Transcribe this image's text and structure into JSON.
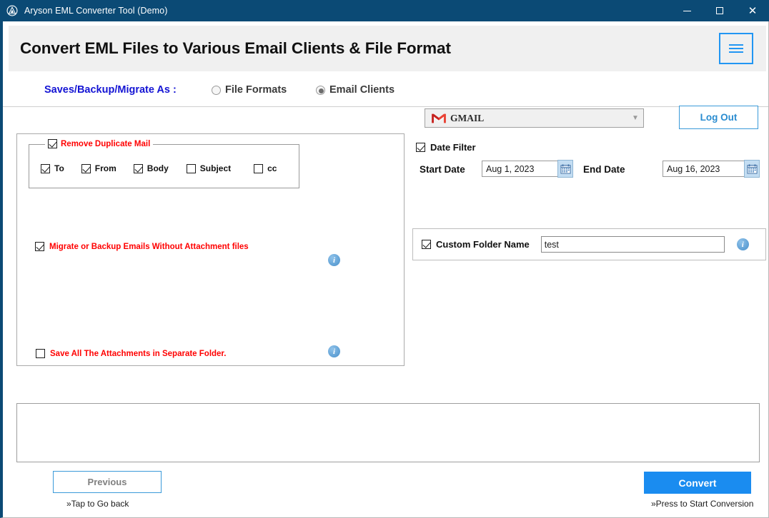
{
  "window": {
    "title": "Aryson EML Converter Tool (Demo)",
    "logo_icon": "aryson-logo-icon",
    "minimize_icon": "minimize-icon",
    "maximize_icon": "maximize-icon",
    "close_icon": "close-icon",
    "titlebar_color": "#0b4a75"
  },
  "header": {
    "title": "Convert EML Files to Various Email Clients & File Format",
    "menu_icon": "hamburger-menu-icon",
    "accent_color": "#2196f3"
  },
  "toolbar": {
    "save_as_label": "Saves/Backup/Migrate As :",
    "save_as_color": "#1414d4",
    "radios": [
      {
        "label": "File Formats",
        "selected": false
      },
      {
        "label": "Email Clients",
        "selected": true
      }
    ],
    "target_combo": {
      "value": "GMAIL",
      "icon": "gmail-icon",
      "chevron_icon": "chevron-down-icon"
    },
    "logout_label": "Log Out",
    "logout_color": "#2a8cd0"
  },
  "left_panel": {
    "duplicate_group": {
      "title": "Remove Duplicate Mail",
      "checked": true,
      "title_color": "#ff0000",
      "options": [
        {
          "label": "To",
          "checked": true
        },
        {
          "label": "From",
          "checked": true
        },
        {
          "label": "Body",
          "checked": true
        },
        {
          "label": "Subject",
          "checked": false
        },
        {
          "label": "cc",
          "checked": false
        }
      ]
    },
    "attachment_option": {
      "label": "Migrate or Backup Emails Without Attachment files",
      "checked": true,
      "color": "#ff0000"
    },
    "separate_folder_option": {
      "label": "Save All The Attachments in Separate Folder.",
      "checked": false,
      "color": "#ff0000"
    },
    "info_icons": [
      "info-icon",
      "info-icon"
    ]
  },
  "right_panel": {
    "date_filter": {
      "label": "Date Filter",
      "checked": true,
      "start_label": "Start Date",
      "start_value": "Aug 1, 2023",
      "end_label": "End Date",
      "end_value": "Aug 16, 2023",
      "calendar_icon": "calendar-icon"
    },
    "custom_folder": {
      "label": "Custom Folder Name",
      "checked": true,
      "value": "test",
      "placeholder": "",
      "info_icon": "info-icon"
    }
  },
  "footer": {
    "previous_label": "Previous",
    "previous_hint": "»Tap to Go back",
    "convert_label": "Convert",
    "convert_hint": "»Press to Start Conversion",
    "convert_color": "#1a8cf0"
  }
}
